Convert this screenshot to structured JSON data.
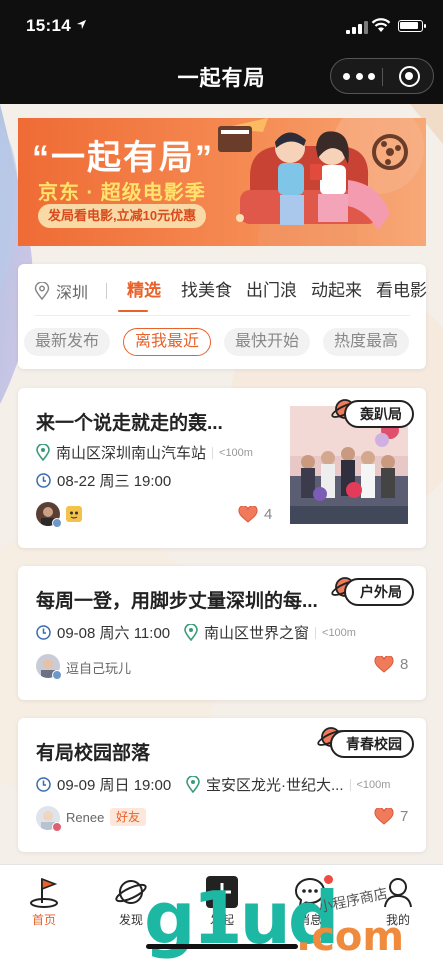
{
  "status_bar": {
    "time": "15:14",
    "location_icon": "location-arrow-icon"
  },
  "nav": {
    "title": "一起有局",
    "more_icon": "more-dots-icon",
    "close_icon": "miniapp-close-icon"
  },
  "banner": {
    "title": "“一起有局”",
    "subtitle": "京东 · 超级电影季",
    "tag": "发局看电影,立减10元优惠"
  },
  "filter": {
    "city": "深圳",
    "tabs": [
      {
        "label": "精选",
        "active": true
      },
      {
        "label": "找美食",
        "active": false
      },
      {
        "label": "出门浪",
        "active": false
      },
      {
        "label": "动起来",
        "active": false
      },
      {
        "label": "看电影",
        "active": false
      }
    ],
    "sorts": [
      {
        "label": "最新发布",
        "active": false
      },
      {
        "label": "离我最近",
        "active": true
      },
      {
        "label": "最快开始",
        "active": false
      },
      {
        "label": "热度最高",
        "active": false
      }
    ]
  },
  "cards": [
    {
      "title": "来一个说走就走的轰...",
      "tag": "轰趴局",
      "location": "南山区深圳南山汽车站",
      "distance": "<100m",
      "time": "08-22 周三 19:00",
      "likes": "4",
      "user_name": "",
      "friend": ""
    },
    {
      "title": "每周一登，用脚步丈量深圳的每...",
      "tag": "户外局",
      "time": "09-08 周六 11:00",
      "location": "南山区世界之窗",
      "distance": "<100m",
      "user_name": "逗自己玩儿",
      "likes": "8",
      "friend": ""
    },
    {
      "title": "有局校园部落",
      "tag": "青春校园",
      "time": "09-09 周日 19:00",
      "location": "宝安区龙光·世纪大...",
      "distance": "<100m",
      "user_name": "Renee",
      "friend": "好友",
      "likes": "7"
    }
  ],
  "tabbar": [
    {
      "label": "首页",
      "icon": "golf-flag-icon",
      "active": true
    },
    {
      "label": "发现",
      "icon": "planet-icon",
      "active": false
    },
    {
      "label": "发起",
      "icon": "plus-icon",
      "active": false
    },
    {
      "label": "消息",
      "icon": "message-icon",
      "active": false
    },
    {
      "label": "我的",
      "icon": "person-icon",
      "active": false
    }
  ],
  "watermark": {
    "text": "g1ud",
    "suffix": ".com",
    "caption": "小程序商店"
  },
  "colors": {
    "accent": "#e8622b",
    "nav_bg": "#0f0f0f",
    "page_bg": "#f4efe9",
    "banner": "#ef6b35"
  }
}
